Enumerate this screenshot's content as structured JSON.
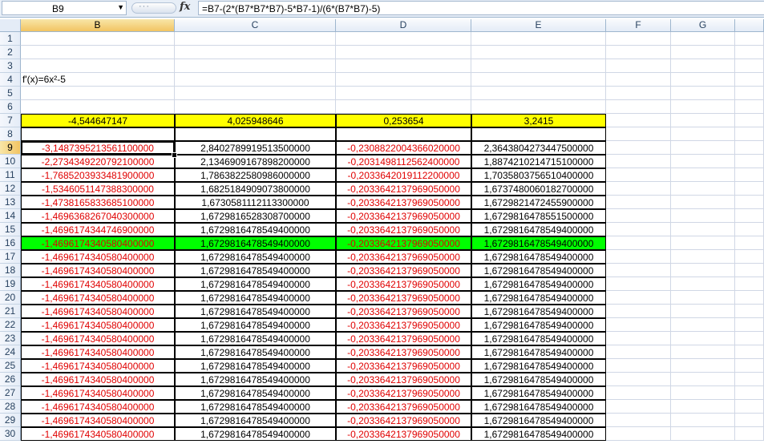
{
  "formula_bar": {
    "name_box": "B9",
    "fx_label": "fx",
    "formula": "=B7-(2*(B7*B7*B7)-5*B7-1)/(6*(B7*B7)-5)"
  },
  "columns": [
    "B",
    "C",
    "D",
    "E",
    "F",
    "G"
  ],
  "rows_label_text": {
    "r4": "f'(x)=6x²-5"
  },
  "row7": [
    "-4,544647147",
    "4,025948646",
    "0,253654",
    "3,2415"
  ],
  "table": [
    {
      "row": "9",
      "b": "-3,1487395213561100000",
      "c": "2,8402789919513500000",
      "d": "-0,2308822004366020000",
      "e": "2,3643804273447500000"
    },
    {
      "row": "10",
      "b": "-2,2734349220792100000",
      "c": "2,1346909167898200000",
      "d": "-0,2031498112562400000",
      "e": "1,8874210214715100000"
    },
    {
      "row": "11",
      "b": "-1,7685203933481900000",
      "c": "1,7863822580986000000",
      "d": "-0,2033642019112200000",
      "e": "1,7035803756510400000"
    },
    {
      "row": "12",
      "b": "-1,5346051147388300000",
      "c": "1,6825184909073800000",
      "d": "-0,2033642137969050000",
      "e": "1,6737480060182700000"
    },
    {
      "row": "13",
      "b": "-1,4738165833685100000",
      "c": "1,6730581112113300000",
      "d": "-0,2033642137969050000",
      "e": "1,6729821472455900000"
    },
    {
      "row": "14",
      "b": "-1,4696368267040300000",
      "c": "1,6729816528308700000",
      "d": "-0,2033642137969050000",
      "e": "1,6729816478551500000"
    },
    {
      "row": "15",
      "b": "-1,4696174344746900000",
      "c": "1,6729816478549400000",
      "d": "-0,2033642137969050000",
      "e": "1,6729816478549400000"
    },
    {
      "row": "16",
      "b": "-1,4696174340580400000",
      "c": "1,6729816478549400000",
      "d": "-0,2033642137969050000",
      "e": "1,6729816478549400000"
    },
    {
      "row": "17",
      "b": "-1,4696174340580400000",
      "c": "1,6729816478549400000",
      "d": "-0,2033642137969050000",
      "e": "1,6729816478549400000"
    },
    {
      "row": "18",
      "b": "-1,4696174340580400000",
      "c": "1,6729816478549400000",
      "d": "-0,2033642137969050000",
      "e": "1,6729816478549400000"
    },
    {
      "row": "19",
      "b": "-1,4696174340580400000",
      "c": "1,6729816478549400000",
      "d": "-0,2033642137969050000",
      "e": "1,6729816478549400000"
    },
    {
      "row": "20",
      "b": "-1,4696174340580400000",
      "c": "1,6729816478549400000",
      "d": "-0,2033642137969050000",
      "e": "1,6729816478549400000"
    },
    {
      "row": "21",
      "b": "-1,4696174340580400000",
      "c": "1,6729816478549400000",
      "d": "-0,2033642137969050000",
      "e": "1,6729816478549400000"
    },
    {
      "row": "22",
      "b": "-1,4696174340580400000",
      "c": "1,6729816478549400000",
      "d": "-0,2033642137969050000",
      "e": "1,6729816478549400000"
    },
    {
      "row": "23",
      "b": "-1,4696174340580400000",
      "c": "1,6729816478549400000",
      "d": "-0,2033642137969050000",
      "e": "1,6729816478549400000"
    },
    {
      "row": "24",
      "b": "-1,4696174340580400000",
      "c": "1,6729816478549400000",
      "d": "-0,2033642137969050000",
      "e": "1,6729816478549400000"
    },
    {
      "row": "25",
      "b": "-1,4696174340580400000",
      "c": "1,6729816478549400000",
      "d": "-0,2033642137969050000",
      "e": "1,6729816478549400000"
    },
    {
      "row": "26",
      "b": "-1,4696174340580400000",
      "c": "1,6729816478549400000",
      "d": "-0,2033642137969050000",
      "e": "1,6729816478549400000"
    },
    {
      "row": "27",
      "b": "-1,4696174340580400000",
      "c": "1,6729816478549400000",
      "d": "-0,2033642137969050000",
      "e": "1,6729816478549400000"
    },
    {
      "row": "28",
      "b": "-1,4696174340580400000",
      "c": "1,6729816478549400000",
      "d": "-0,2033642137969050000",
      "e": "1,6729816478549400000"
    },
    {
      "row": "29",
      "b": "-1,4696174340580400000",
      "c": "1,6729816478549400000",
      "d": "-0,2033642137969050000",
      "e": "1,6729816478549400000"
    },
    {
      "row": "30",
      "b": "-1,4696174340580400000",
      "c": "1,6729816478549400000",
      "d": "-0,2033642137969050000",
      "e": "1,6729816478549400000"
    }
  ],
  "highlight_row": "16",
  "colors": {
    "header_bg": "#e4ecf7",
    "selected_header": "#f2c462",
    "yellow_fill": "#ffff00",
    "green_fill": "#00ff00",
    "negative_text": "#e00000"
  }
}
